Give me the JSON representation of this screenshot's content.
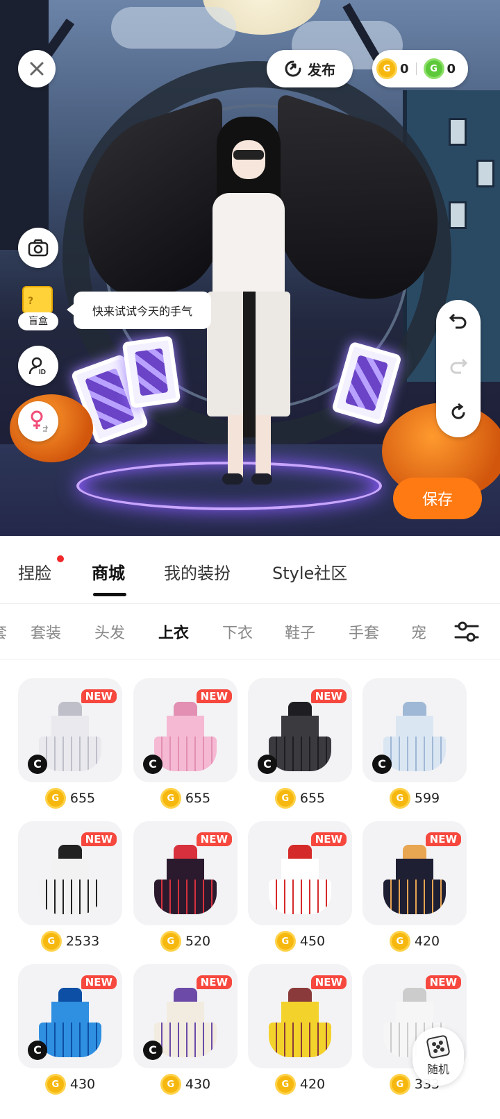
{
  "top_bar": {
    "close_icon": "close-icon",
    "publish_label": "发布",
    "publish_icon": "publish-icon",
    "currency_gold_amount": "0",
    "currency_green_amount": "0",
    "coin_glyph": "G"
  },
  "left_tools": {
    "camera_icon": "camera-icon",
    "blind_box_label": "盲盒",
    "bubble_text": "快来试试今天的手气",
    "id_icon": "id-icon",
    "gender_icon": "gender-switch-icon"
  },
  "right_tools": {
    "undo_icon": "undo-icon",
    "redo_icon": "redo-icon",
    "reset_icon": "reset-icon",
    "save_label": "保存"
  },
  "main_tabs": [
    {
      "label": "捏脸",
      "active": false,
      "dot": true
    },
    {
      "label": "商城",
      "active": true,
      "dot": false
    },
    {
      "label": "我的装扮",
      "active": false,
      "dot": false
    },
    {
      "label": "Style社区",
      "active": false,
      "dot": false
    }
  ],
  "sub_tabs": [
    {
      "label": "套",
      "active": false
    },
    {
      "label": "套装",
      "active": false
    },
    {
      "label": "头发",
      "active": false
    },
    {
      "label": "上衣",
      "active": true
    },
    {
      "label": "下衣",
      "active": false
    },
    {
      "label": "鞋子",
      "active": false
    },
    {
      "label": "手套",
      "active": false
    },
    {
      "label": "宠",
      "active": false
    }
  ],
  "badge_text": "NEW",
  "creator_mark": "C",
  "items": [
    {
      "price": "655",
      "new": true,
      "creator": true,
      "color": "#e9e9ee",
      "accent": "#bfbfca"
    },
    {
      "price": "655",
      "new": true,
      "creator": true,
      "color": "#f5b9d3",
      "accent": "#e28fb3"
    },
    {
      "price": "655",
      "new": true,
      "creator": true,
      "color": "#3a3a3f",
      "accent": "#1d1d22"
    },
    {
      "price": "599",
      "new": false,
      "creator": true,
      "color": "#dbe6f3",
      "accent": "#9fb8d6"
    },
    {
      "price": "2533",
      "new": true,
      "creator": false,
      "color": "#f2f2f2",
      "accent": "#222222"
    },
    {
      "price": "520",
      "new": true,
      "creator": false,
      "color": "#2b1a2e",
      "accent": "#d8313d"
    },
    {
      "price": "450",
      "new": true,
      "creator": false,
      "color": "#ffffff",
      "accent": "#d52a2a"
    },
    {
      "price": "420",
      "new": true,
      "creator": false,
      "color": "#1e1f33",
      "accent": "#e8a552"
    },
    {
      "price": "430",
      "new": true,
      "creator": true,
      "color": "#2f8fe0",
      "accent": "#0d4fa4"
    },
    {
      "price": "430",
      "new": true,
      "creator": true,
      "color": "#f2ece0",
      "accent": "#6b4aa8"
    },
    {
      "price": "420",
      "new": true,
      "creator": false,
      "color": "#f3d22b",
      "accent": "#8a3a3a"
    },
    {
      "price": "333",
      "new": true,
      "creator": false,
      "color": "#f6f6f6",
      "accent": "#cccccc"
    }
  ],
  "random_button": {
    "label": "随机",
    "icon": "dice-icon"
  }
}
